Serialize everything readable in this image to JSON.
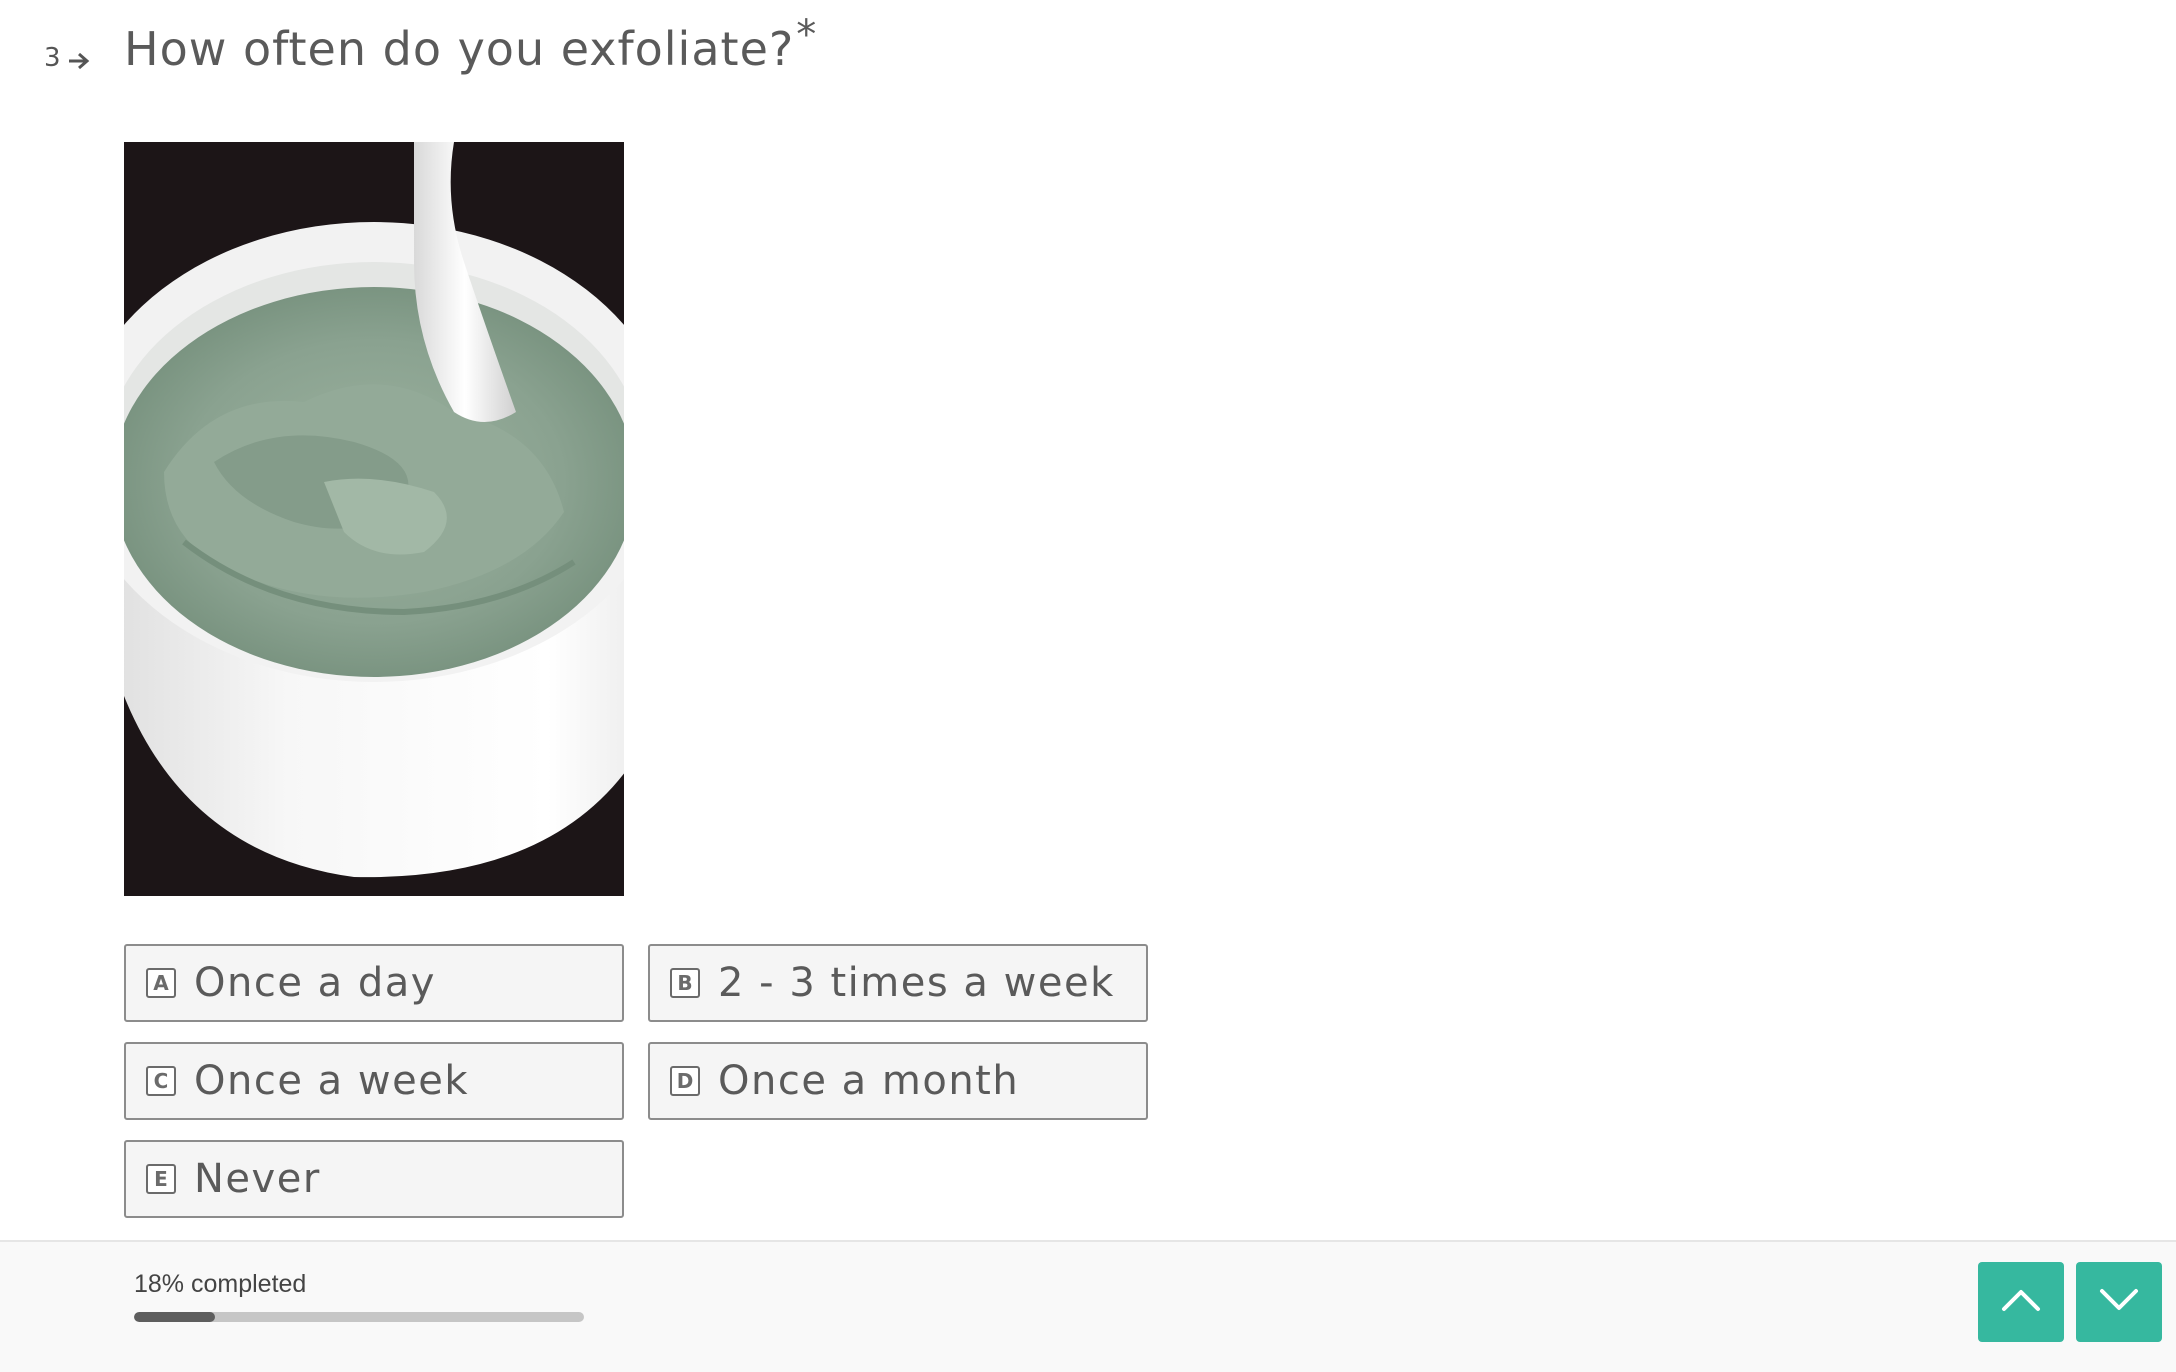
{
  "question": {
    "number": "3",
    "title": "How often do you exfoliate?",
    "required_mark": "*"
  },
  "image": {
    "subject": "green clay mask in white bowl with spoon"
  },
  "choices": [
    {
      "key": "A",
      "label": "Once a day"
    },
    {
      "key": "B",
      "label": "2 - 3 times a week"
    },
    {
      "key": "C",
      "label": "Once a week"
    },
    {
      "key": "D",
      "label": "Once a month"
    },
    {
      "key": "E",
      "label": "Never"
    }
  ],
  "footer": {
    "progress_text": "18% completed",
    "progress_percent": 18
  },
  "colors": {
    "accent": "#36b89f",
    "progress_fill": "#5e5e5e",
    "progress_track": "#c6c6c6"
  },
  "icons": {
    "question_arrow": "arrow-right-icon",
    "nav_up": "chevron-up-icon",
    "nav_down": "chevron-down-icon"
  }
}
